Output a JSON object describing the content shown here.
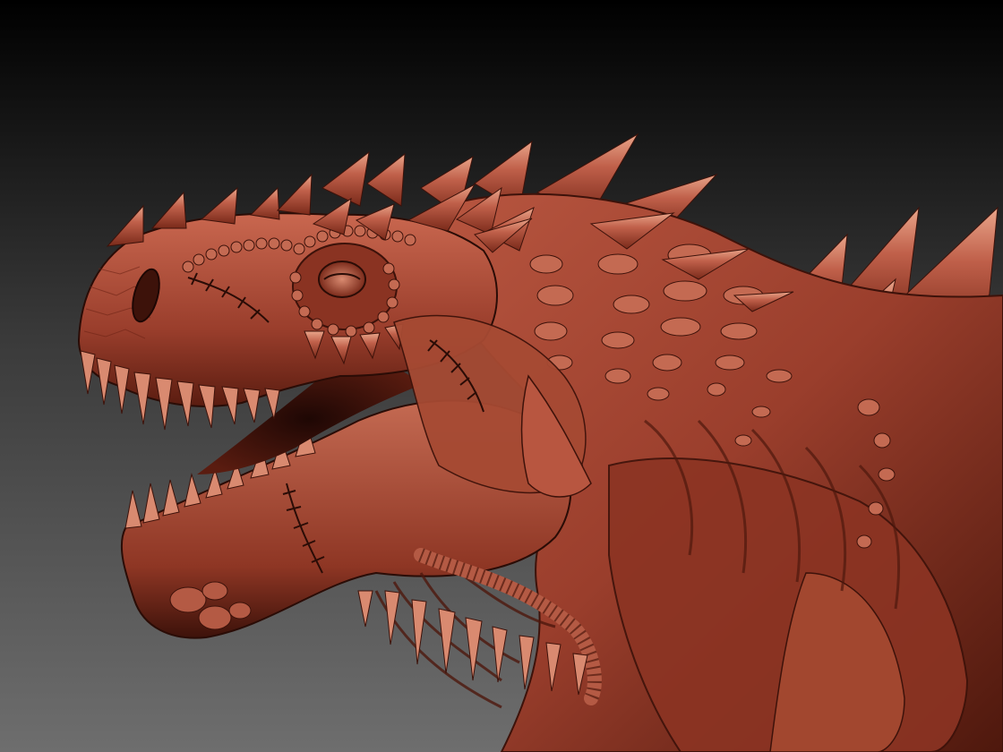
{
  "scene": {
    "subject": "dinosaur-sculpt-render",
    "background_gradient": [
      "#000000",
      "#3a3a3a",
      "#6e6e6e"
    ],
    "material_colors": {
      "base": "#9a3e2c",
      "mid": "#b85640",
      "highlight": "#d98a70",
      "shadow": "#3d120a",
      "deep_shadow": "#1e0704",
      "spike_tip": "#e9a58a"
    }
  }
}
